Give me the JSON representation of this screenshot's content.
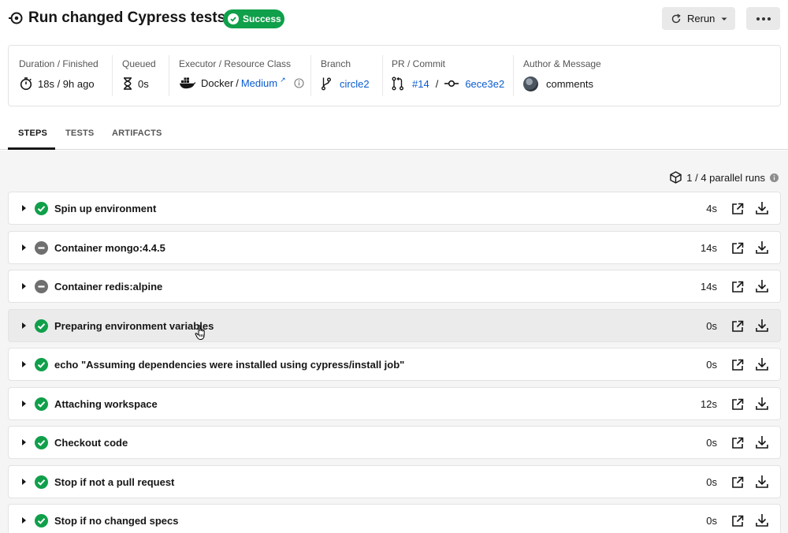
{
  "header": {
    "title": "Run changed Cypress tests",
    "status_badge": "Success",
    "rerun_label": "Rerun",
    "job_icon": "pipeline-dot-icon",
    "more_icon": "more-horizontal-icon"
  },
  "summary": {
    "duration": {
      "label": "Duration / Finished",
      "value": "18s / 9h ago",
      "icon": "stopwatch-icon"
    },
    "queued": {
      "label": "Queued",
      "value": "0s",
      "icon": "hourglass-icon"
    },
    "executor": {
      "label": "Executor / Resource Class",
      "executor": "Docker",
      "separator": "/",
      "resource_class": "Medium",
      "icon": "docker-icon"
    },
    "branch": {
      "label": "Branch",
      "value": "circle2",
      "icon": "branch-icon"
    },
    "pr_commit": {
      "label": "PR / Commit",
      "pr": "#14",
      "separator": "/",
      "commit": "6ece3e2"
    },
    "author": {
      "label": "Author & Message",
      "message": "comments"
    }
  },
  "tabs": [
    "STEPS",
    "TESTS",
    "ARTIFACTS"
  ],
  "active_tab": "STEPS",
  "parallel_runs": "1 / 4 parallel runs",
  "steps": [
    {
      "name": "Spin up environment",
      "duration": "4s",
      "status": "success"
    },
    {
      "name": "Container mongo:4.4.5",
      "duration": "14s",
      "status": "neutral"
    },
    {
      "name": "Container redis:alpine",
      "duration": "14s",
      "status": "neutral"
    },
    {
      "name": "Preparing environment variables",
      "duration": "0s",
      "status": "success"
    },
    {
      "name": "echo \"Assuming dependencies were installed using cypress/install job\"",
      "duration": "0s",
      "status": "success"
    },
    {
      "name": "Attaching workspace",
      "duration": "12s",
      "status": "success"
    },
    {
      "name": "Checkout code",
      "duration": "0s",
      "status": "success"
    },
    {
      "name": "Stop if not a pull request",
      "duration": "0s",
      "status": "success"
    },
    {
      "name": "Stop if no changed specs",
      "duration": "0s",
      "status": "success"
    }
  ],
  "colors": {
    "success": "#109f4a",
    "neutral": "#6f6f6f",
    "link": "#0a5cd1"
  }
}
